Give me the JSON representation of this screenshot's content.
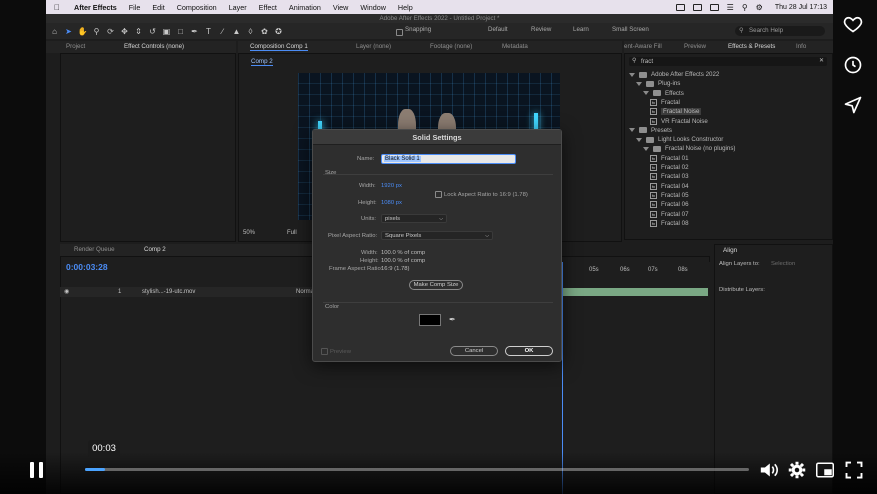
{
  "menubar": {
    "app": "After Effects",
    "items": [
      "File",
      "Edit",
      "Composition",
      "Layer",
      "Effect",
      "Animation",
      "View",
      "Window",
      "Help"
    ],
    "clock": "Thu 28 Jul  17:13"
  },
  "window_title": "Adobe After Effects 2022 - Untitled Project *",
  "toolbar": {
    "snapping": "Snapping",
    "workspaces": [
      "Default",
      "Review",
      "Learn",
      "Small Screen"
    ],
    "search_placeholder": "Search Help"
  },
  "left_panel": {
    "tabs": [
      "Project",
      "Effect Controls (none)"
    ]
  },
  "comp_panel": {
    "tabs": [
      "Composition  Comp 1",
      "Layer (none)",
      "Footage (none)",
      "Metadata"
    ],
    "breadcrumb": "Comp 2",
    "zoom": "50%",
    "resolution": "Full"
  },
  "right_panel": {
    "tabs": [
      "ent-Aware Fill",
      "Preview",
      "Effects & Presets",
      "Info"
    ],
    "search_value": "fract",
    "tree": [
      {
        "label": "Adobe After Effects 2022",
        "kind": "folder",
        "level": 0
      },
      {
        "label": "Plug-ins",
        "kind": "folder",
        "level": 1
      },
      {
        "label": "Effects",
        "kind": "folder",
        "level": 2
      },
      {
        "label": "Fractal",
        "kind": "fx",
        "level": 3
      },
      {
        "label": "Fractal Noise",
        "kind": "fx",
        "level": 3,
        "selected": true
      },
      {
        "label": "VR Fractal Noise",
        "kind": "fx",
        "level": 3
      },
      {
        "label": "Presets",
        "kind": "folder",
        "level": 0
      },
      {
        "label": "Light Looks Constructor",
        "kind": "folder",
        "level": 1
      },
      {
        "label": "Fractal Noise (no plugins)",
        "kind": "folder",
        "level": 2
      },
      {
        "label": "Fractal 01",
        "kind": "fx",
        "level": 3
      },
      {
        "label": "Fractal 02",
        "kind": "fx",
        "level": 3
      },
      {
        "label": "Fractal 03",
        "kind": "fx",
        "level": 3
      },
      {
        "label": "Fractal 04",
        "kind": "fx",
        "level": 3
      },
      {
        "label": "Fractal 05",
        "kind": "fx",
        "level": 3
      },
      {
        "label": "Fractal 06",
        "kind": "fx",
        "level": 3
      },
      {
        "label": "Fractal 07",
        "kind": "fx",
        "level": 3
      },
      {
        "label": "Fractal 08",
        "kind": "fx",
        "level": 3
      }
    ]
  },
  "align_panel": {
    "title": "Align",
    "align_to_label": "Align Layers to:",
    "align_to_value": "Selection",
    "distribute_label": "Distribute Layers:"
  },
  "timeline": {
    "tabs": [
      "Render Queue",
      "Comp 2"
    ],
    "timecode": "0:00:03:28",
    "layer_index": "1",
    "layer_name": "stylish...-19-utc.mov",
    "mode": "Normal",
    "ruler": [
      "05s",
      "06s",
      "07s",
      "08s"
    ]
  },
  "dialog": {
    "title": "Solid Settings",
    "name_label": "Name:",
    "name_value": "Black Solid 1",
    "size_label": "Size",
    "width_label": "Width:",
    "width_value": "1920 px",
    "height_label": "Height:",
    "height_value": "1080 px",
    "lock_label": "Lock Aspect Ratio to 16:9 (1.78)",
    "units_label": "Units:",
    "units_value": "pixels",
    "par_label": "Pixel Aspect Ratio:",
    "par_value": "Square Pixels",
    "info_width_label": "Width:",
    "info_width_value": "100.0 % of comp",
    "info_height_label": "Height:",
    "info_height_value": "100.0 % of comp",
    "info_far_label": "Frame Aspect Ratio:",
    "info_far_value": "16:9 (1.78)",
    "make_comp_size": "Make Comp Size",
    "color_label": "Color",
    "preview_label": "Preview",
    "cancel": "Cancel",
    "ok": "OK",
    "swatch_color": "#000000"
  },
  "player": {
    "time_tooltip": "00:03",
    "progress_fraction": 0.03,
    "accent": "#4aa3ff"
  }
}
